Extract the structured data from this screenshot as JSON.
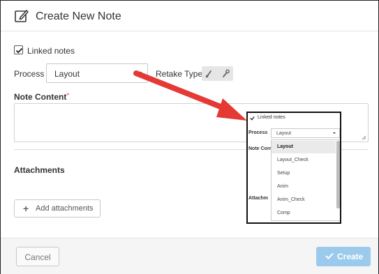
{
  "dialog": {
    "title": "Create New Note",
    "linked_notes_label": "Linked notes",
    "linked_notes_checked": true,
    "process_label": "Process",
    "process_value": "Layout",
    "retake_type_label": "Retake Type",
    "note_content_label": "Note Content",
    "required_mark": "*",
    "note_content_value": "",
    "attachments_label": "Attachments",
    "add_attachments_label": "Add attachments",
    "add_attachments_icon": "+",
    "cancel_label": "Cancel",
    "create_label": "Create"
  },
  "inset": {
    "linked_notes_label": "Linked notes",
    "process_label": "Process",
    "process_value": "Layout",
    "note_content_label": "Note Cont",
    "attachments_label": "Attachm",
    "options": [
      "Layout",
      "Layout_Check",
      "Setup",
      "Anim",
      "Anim_Check",
      "Comp"
    ],
    "selected_option": "Layout"
  },
  "colors": {
    "required": "#e74c3c",
    "arrow": "#e53935",
    "create_button": "#9ccaec",
    "footer": "#f5f5f5"
  },
  "icons": {
    "title_icon": "edit-note-icon",
    "retake_icons": [
      "brush-icon",
      "wrench-icon"
    ],
    "create_icon": "check-icon"
  }
}
